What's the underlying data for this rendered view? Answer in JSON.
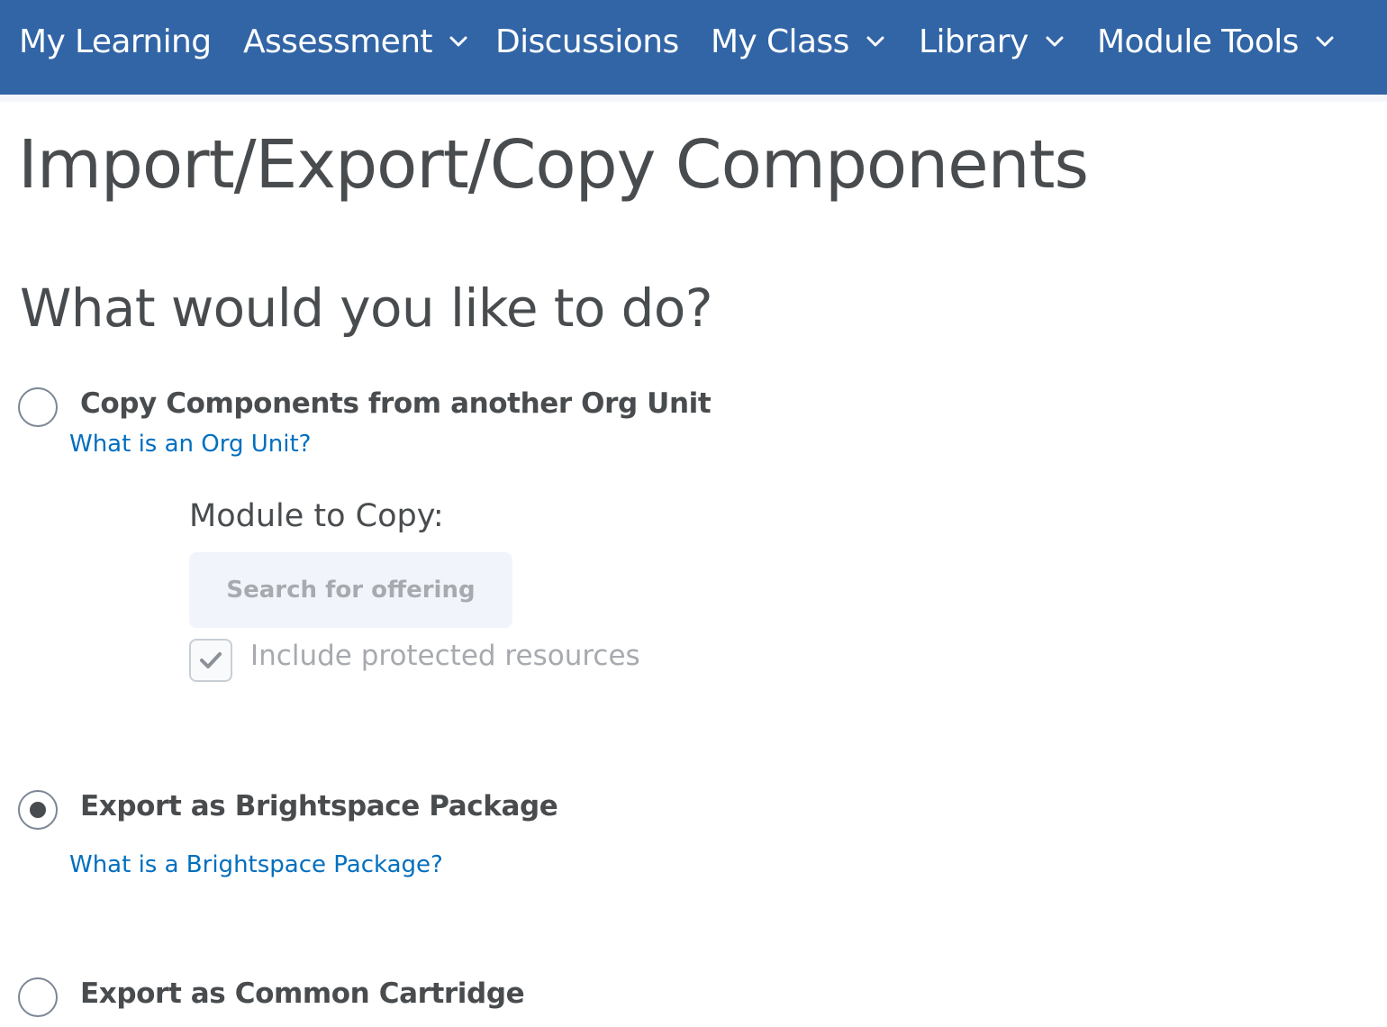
{
  "nav": {
    "items": [
      {
        "label": "My Learning",
        "has_menu": false
      },
      {
        "label": "Assessment",
        "has_menu": true
      },
      {
        "label": "Discussions",
        "has_menu": false
      },
      {
        "label": "My Class",
        "has_menu": true
      },
      {
        "label": "Library",
        "has_menu": true
      },
      {
        "label": "Module Tools",
        "has_menu": true
      }
    ],
    "background_color": "#3265a6"
  },
  "page": {
    "title": "Import/Export/Copy Components",
    "question": "What would you like to do?"
  },
  "options": [
    {
      "label": "Copy Components from another Org Unit",
      "help_link": "What is an Org Unit?",
      "selected": false
    },
    {
      "label": "Export as Brightspace Package",
      "help_link": "What is a Brightspace Package?",
      "selected": true
    },
    {
      "label": "Export as Common Cartridge",
      "selected": false
    }
  ],
  "copy_section": {
    "module_label": "Module to Copy:",
    "search_button_label": "Search for offering",
    "include_protected_label": "Include protected resources",
    "include_protected_checked": true,
    "disabled": true
  },
  "colors": {
    "link": "#006fbf",
    "text": "#494c4e",
    "disabled_text": "#a7aaae"
  }
}
